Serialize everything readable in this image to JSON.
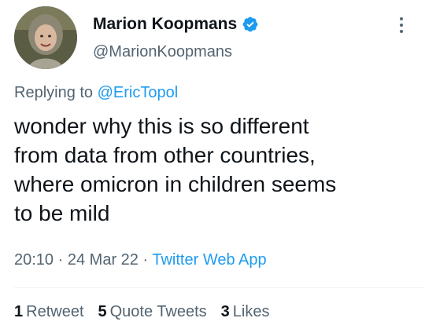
{
  "author": {
    "display_name": "Marion Koopmans",
    "handle": "@MarionKoopmans",
    "verified": true
  },
  "reply": {
    "prefix": "Replying to",
    "mention": "@EricTopol"
  },
  "tweet": {
    "text": "wonder why this is so different\nfrom data from other countries,\nwhere omicron in children seems\nto be mild"
  },
  "meta": {
    "time": "20:10",
    "sep1": "·",
    "date": "24 Mar 22",
    "sep2": "·",
    "source": "Twitter Web App"
  },
  "stats": {
    "retweets_count": "1",
    "retweets_label": "Retweet",
    "quotes_count": "5",
    "quotes_label": "Quote Tweets",
    "likes_count": "3",
    "likes_label": "Likes"
  },
  "colors": {
    "accent": "#1d9bf0",
    "text": "#0f1419",
    "secondary": "#536471"
  },
  "icons": {
    "verified": "verified-badge-icon",
    "more": "more-options-icon"
  }
}
